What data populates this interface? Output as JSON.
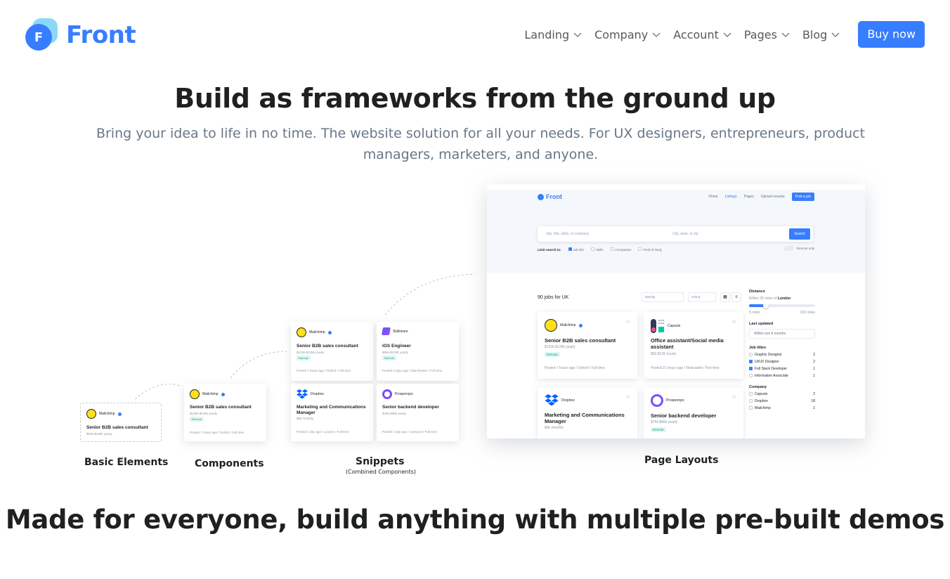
{
  "header": {
    "logo_letter": "F",
    "logo_text": "Front",
    "nav": [
      "Landing",
      "Company",
      "Account",
      "Pages",
      "Blog"
    ],
    "buy_label": "Buy now",
    "accent": "#377dff"
  },
  "hero": {
    "title": "Build as frameworks from the ground up",
    "subtitle": "Bring your idea to life in no time. The website solution for all your needs. For UX designers, entrepreneurs, product managers, marketers, and anyone."
  },
  "showcase": {
    "captions": {
      "basic": "Basic Elements",
      "components": "Components",
      "snippets": "Snippets",
      "snippets_sub": "(Combined Components)",
      "layouts": "Page Layouts"
    },
    "basic_card": {
      "company": "Mailchimp",
      "title": "Senior B2B sales consultant",
      "salary": "$50k-$100k yearly"
    },
    "component_card": {
      "company": "Mailchimp",
      "title": "Senior B2B sales consultant",
      "salary": "$125k-$135k yearly",
      "badge": "Remote",
      "footer": "Posted 7 hours ago  /  Oxford  /  Full time"
    },
    "snippet_cards": [
      {
        "company": "Mailchimp",
        "title": "Senior B2B sales consultant",
        "salary": "$125k-$135k yearly",
        "badge": "Remote",
        "footer": "Posted 7 hours ago  /  Oxford  /  Full time"
      },
      {
        "company": "Skillshare",
        "title": "iOS Engineer",
        "salary": "$50k-$100k yearly",
        "badge": "Remote",
        "footer": "Posted 3 days ago  /  Manchester  /  Full time"
      },
      {
        "company": "Dropbox",
        "title": "Marketing and Communications Manager",
        "salary": "$6k monthly",
        "footer": "Posted 1 day ago  /  London  /  Full time"
      },
      {
        "company": "Prosperops",
        "title": "Senior backend developer",
        "salary": "$75k-$85k yearly",
        "footer": "Posted 1 day ago  /  Liverpool  /  Full time"
      }
    ],
    "page_layout": {
      "logo": "Front",
      "nav": [
        "Home",
        "Listings",
        "Pages",
        "Upload resume"
      ],
      "post_job": "Post a job",
      "search_what": "Job, title, skills, or company",
      "search_where": "City, state, or zip",
      "search_btn": "Search",
      "limit_label": "Limit search to:",
      "limit_options": [
        "Job title",
        "Skills",
        "Companies",
        "Field of study"
      ],
      "remote_only": "Remote only",
      "jobs_count": "90 jobs for UK",
      "sort_by": "Sort by",
      "order": "A-to-Z",
      "jobs": [
        {
          "company": "Mailchimp",
          "title": "Senior B2B sales consultant",
          "salary": "$125k-$135k yearly",
          "badge": "Remote",
          "footer": "Posted 7 hours ago  /  Oxford  /  Full time"
        },
        {
          "company": "Capsule",
          "title": "Office assistant/Social media assistant",
          "salary": "$50-$135 hourly",
          "footer": "Posted 21 hours ago  /  Newcastle  /  Part time"
        },
        {
          "company": "Dropbox",
          "title": "Marketing and Communications Manager",
          "salary": "$5k monthly"
        },
        {
          "company": "Prosperops",
          "title": "Senior backend developer",
          "salary": "$75k-$85k yearly",
          "badge": "Remote"
        }
      ],
      "sidebar": {
        "distance": "Distance",
        "within": "Within 25 miles of",
        "within_city": "London",
        "min": "5 miles",
        "max": "100 miles",
        "last_updated": "Last updated",
        "last_updated_value": "Within last 6 months",
        "job_titles": "Job titles",
        "titles": [
          {
            "label": "Graphic Designer",
            "count": "2",
            "checked": false
          },
          {
            "label": "UI/UX Designer",
            "count": "2",
            "checked": true
          },
          {
            "label": "Full Stack Developer",
            "count": "1",
            "checked": true
          },
          {
            "label": "Information Associate",
            "count": "1",
            "checked": false
          }
        ],
        "company": "Company",
        "companies": [
          {
            "label": "Capsule",
            "count": "2"
          },
          {
            "label": "Dropbox",
            "count": "18"
          },
          {
            "label": "Mailchimp",
            "count": "1"
          }
        ]
      }
    }
  },
  "bottom": {
    "title": "Made for everyone, build anything with multiple pre-built demos"
  }
}
